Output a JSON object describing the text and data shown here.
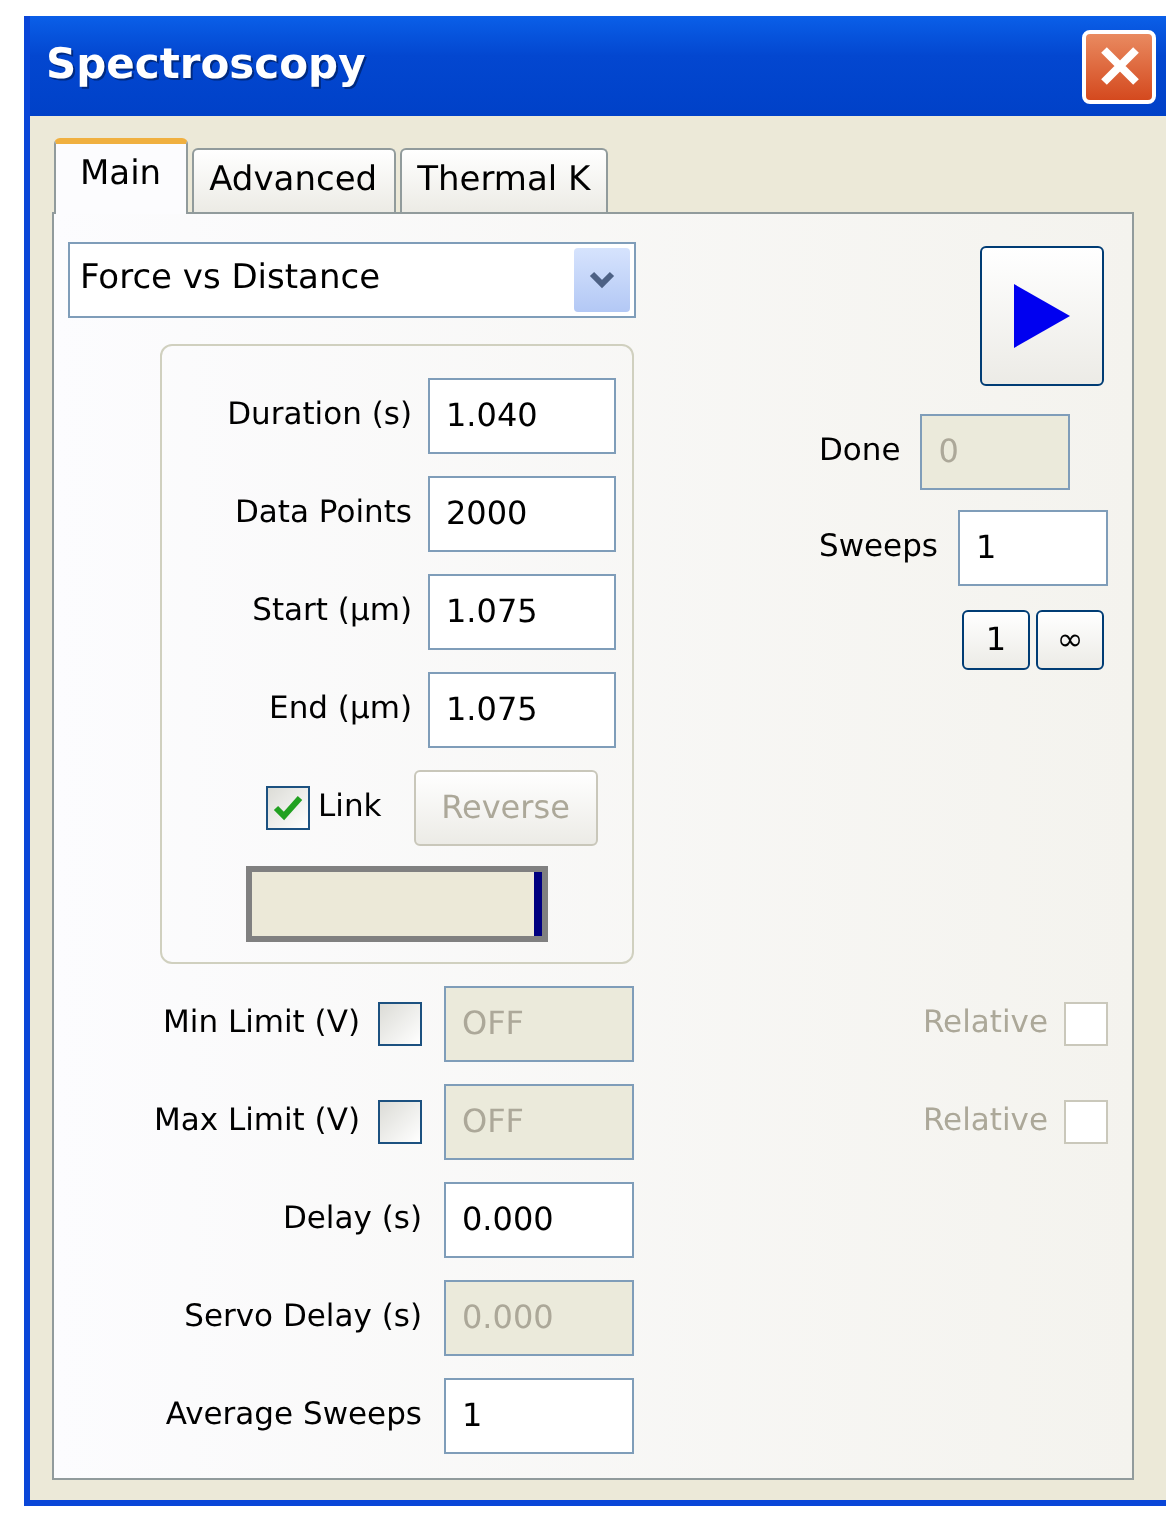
{
  "window": {
    "title": "Spectroscopy"
  },
  "tabs": [
    {
      "label": "Main",
      "selected": true
    },
    {
      "label": "Advanced",
      "selected": false
    },
    {
      "label": "Thermal K",
      "selected": false
    }
  ],
  "mode_dropdown": {
    "value": "Force vs Distance"
  },
  "ramp_fields": [
    {
      "label": "Duration (s)",
      "value": "1.040"
    },
    {
      "label": "Data Points",
      "value": "2000"
    },
    {
      "label": "Start (µm)",
      "value": "1.075"
    },
    {
      "label": "End (µm)",
      "value": "1.075"
    }
  ],
  "link": {
    "label": "Link",
    "checked": true
  },
  "reverse_button": {
    "label": "Reverse",
    "disabled": true
  },
  "ramp_indicator": {
    "level": 1
  },
  "limits": [
    {
      "label": "Min Limit (V)",
      "checked": false,
      "value": "OFF",
      "disabled": true,
      "relative": {
        "label": "Relative",
        "checked": false,
        "disabled": true
      }
    },
    {
      "label": "Max Limit (V)",
      "checked": false,
      "value": "OFF",
      "disabled": true,
      "relative": {
        "label": "Relative",
        "checked": false,
        "disabled": true
      }
    }
  ],
  "delay_fields": [
    {
      "label": "Delay (s)",
      "value": "0.000",
      "disabled": false
    },
    {
      "label": "Servo Delay (s)",
      "value": "0.000",
      "disabled": true
    },
    {
      "label": "Average Sweeps",
      "value": "1",
      "disabled": false
    }
  ],
  "run": {
    "done": {
      "label": "Done",
      "value": "0",
      "disabled": true
    },
    "sweeps": {
      "label": "Sweeps",
      "value": "1",
      "disabled": false
    },
    "presets": [
      "1",
      "∞"
    ]
  }
}
